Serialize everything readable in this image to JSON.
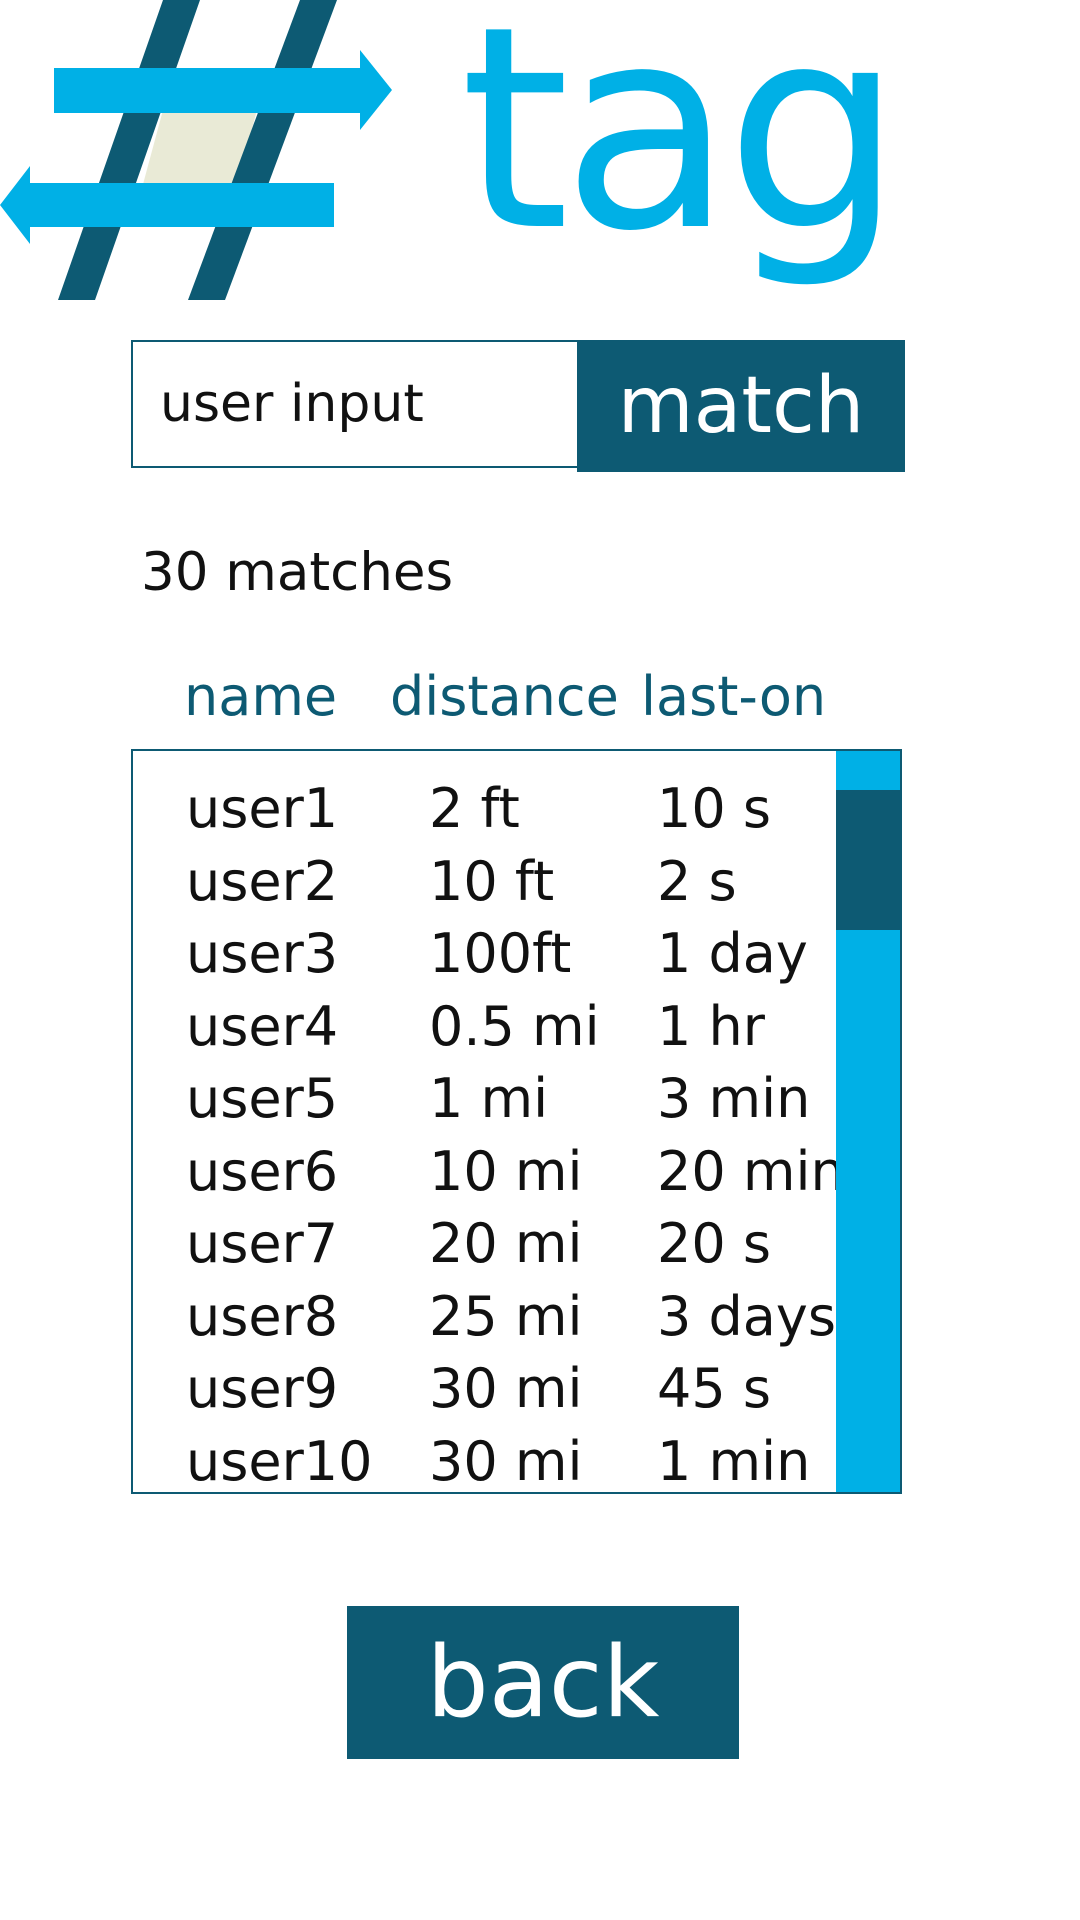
{
  "theme": {
    "primary": "#0d5a73",
    "accent": "#00b0e6",
    "logo_fill": "#e9ead6"
  },
  "logo": {
    "icon": "hashtag-arrows-icon",
    "word": "tag"
  },
  "search": {
    "placeholder": "user input",
    "value": "",
    "button_label": "match"
  },
  "results": {
    "count_label": "30 matches",
    "columns": {
      "name": "name",
      "distance": "distance",
      "last_on": "last-on"
    },
    "rows": [
      {
        "name": "user1",
        "distance": "2 ft",
        "last_on": "10 s"
      },
      {
        "name": "user2",
        "distance": "10 ft",
        "last_on": "2 s"
      },
      {
        "name": "user3",
        "distance": "100ft",
        "last_on": "1 day"
      },
      {
        "name": "user4",
        "distance": "0.5 mi",
        "last_on": "1 hr"
      },
      {
        "name": "user5",
        "distance": "1 mi",
        "last_on": "3 min"
      },
      {
        "name": "user6",
        "distance": "10 mi",
        "last_on": "20 min"
      },
      {
        "name": "user7",
        "distance": "20 mi",
        "last_on": "20 s"
      },
      {
        "name": "user8",
        "distance": "25 mi",
        "last_on": "3 days"
      },
      {
        "name": "user9",
        "distance": "30 mi",
        "last_on": "45 s"
      },
      {
        "name": "user10",
        "distance": "30 mi",
        "last_on": "1 min"
      }
    ]
  },
  "back_button": {
    "label": "back"
  }
}
